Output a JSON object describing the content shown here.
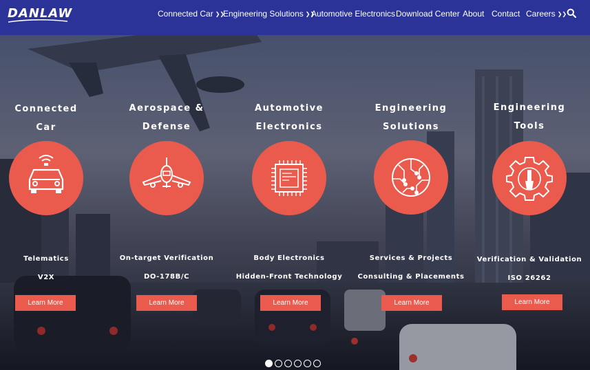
{
  "brand": {
    "logo_text": "DANLAW"
  },
  "nav": {
    "items": [
      {
        "label": "Connected Car",
        "has_dropdown": true
      },
      {
        "label": "Engineering Solutions",
        "has_dropdown": true
      },
      {
        "label": "Automotive Electronics",
        "has_dropdown": false
      },
      {
        "label": "Download Center",
        "has_dropdown": false
      },
      {
        "label": "About",
        "has_dropdown": false
      },
      {
        "label": "Contact",
        "has_dropdown": false
      },
      {
        "label": "Careers",
        "has_dropdown": true
      }
    ],
    "dropdown_icon": "double-chevron-down-icon",
    "search_icon": "search-icon"
  },
  "cards": [
    {
      "title_1": "Connected",
      "title_2": "Car",
      "icon": "connected-car-icon",
      "line1": "Telematics",
      "line2": "V2X",
      "button": "Learn More"
    },
    {
      "title_1": "Aerospace &",
      "title_2": "Defense",
      "icon": "airplane-icon",
      "line1": "On-target Verification",
      "line2": "DO-178B/C",
      "button": "Learn More"
    },
    {
      "title_1": "Automotive",
      "title_2": "Electronics",
      "icon": "chip-icon",
      "line1": "Body Electronics",
      "line2": "Hidden-Front Technology",
      "button": "Learn More"
    },
    {
      "title_1": "Engineering",
      "title_2": "Solutions",
      "icon": "circuit-brain-icon",
      "line1": "Services & Projects",
      "line2": "Consulting & Placements",
      "button": "Learn More"
    },
    {
      "title_1": "Engineering",
      "title_2": "Tools",
      "icon": "gear-wrench-icon",
      "line1": "Verification & Validation",
      "line2": "ISO 26262",
      "button": "Learn More"
    }
  ],
  "slider": {
    "total": 6,
    "active_index": 0
  },
  "colors": {
    "nav_bg": "#2b3398",
    "accent": "#ea5b4d",
    "text": "#ffffff"
  }
}
